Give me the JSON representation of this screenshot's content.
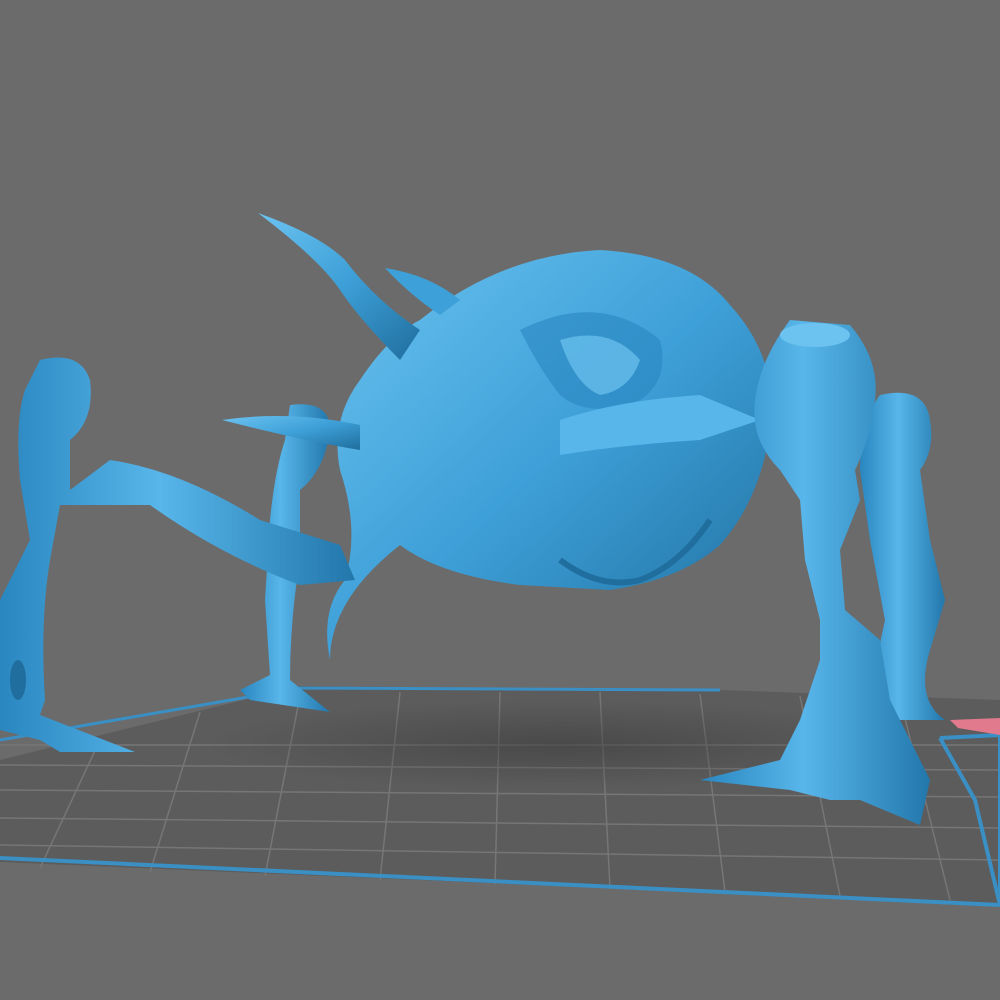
{
  "viewport": {
    "background_color": "#6b6b6b",
    "bed_color": "#5c5c5c",
    "grid_color": "#7a7a7a",
    "bed_border_color": "#3a8fc4",
    "model_color": "#3ea0d8",
    "model_highlight_color": "#6cc3f0",
    "model_shadow_color": "#1f6e9e",
    "axis_marker_color": "#e07a8c"
  }
}
